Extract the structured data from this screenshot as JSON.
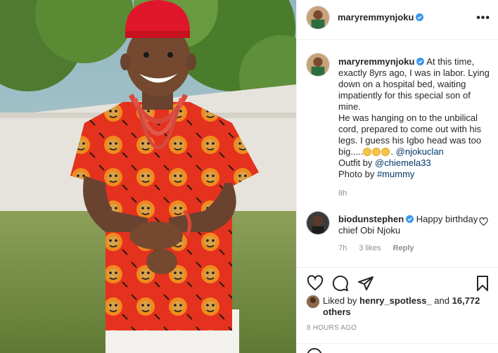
{
  "post": {
    "author": "maryremmynjoku",
    "more_label": "•••",
    "caption": {
      "author": "maryremmynjoku",
      "line1": "At this time, exactly 8yrs ago, I was in labor. Lying down on a hospital bed, waiting impatiently for this special son of mine.",
      "line2": "He was hanging on to the unbilical cord, prepared to come out with his legs. I guess his Igbo head was too big.....",
      "mention_clan": "@njokuclan",
      "outfit_label": "Outfit by",
      "outfit_mention": "@chiemela33",
      "photo_label": "Photo by",
      "photo_tag": "#mummy",
      "time": "8h"
    },
    "comment": {
      "author": "biodunstephen",
      "text": "Happy birthday chief Obi Njoku",
      "time": "7h",
      "likes": "3 likes",
      "reply": "Reply"
    },
    "liked_by": {
      "prefix": "Liked by",
      "user": "henry_spotless_",
      "and": "and",
      "others": "16,772 others"
    },
    "posted_ago": "8 HOURS AGO"
  },
  "icons": {
    "verified": "verified-badge-icon",
    "heart": "heart-icon",
    "comment": "comment-icon",
    "share": "paper-plane-icon",
    "save": "bookmark-icon"
  },
  "colors": {
    "link": "#00376b",
    "verified": "#3897f0",
    "muted": "#8e8e8e"
  }
}
